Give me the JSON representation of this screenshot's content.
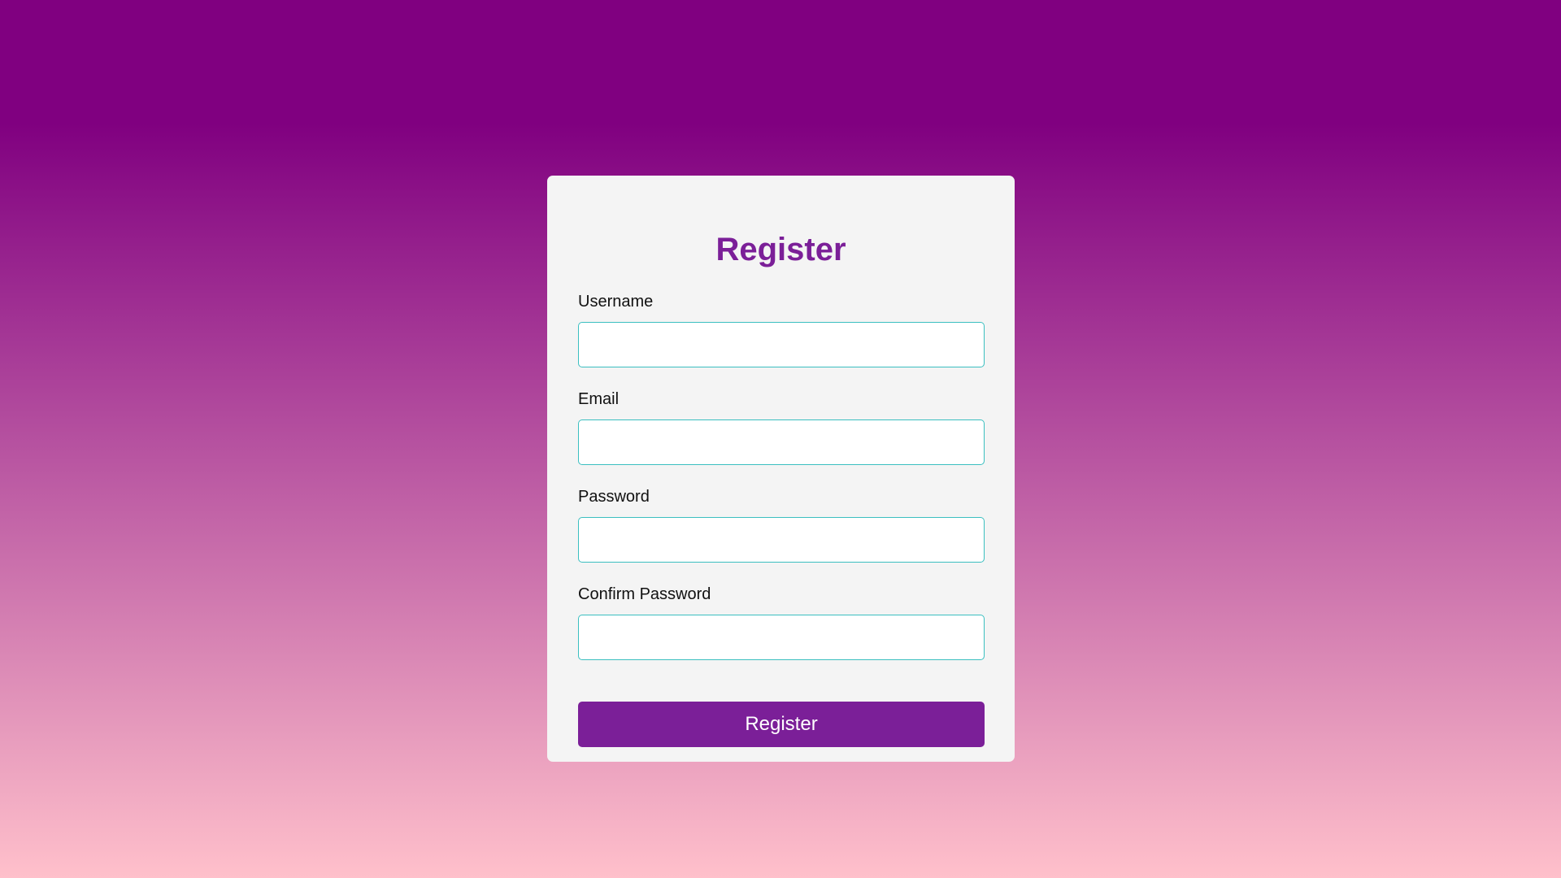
{
  "form": {
    "title": "Register",
    "fields": [
      {
        "label": "Username",
        "value": "",
        "placeholder": ""
      },
      {
        "label": "Email",
        "value": "",
        "placeholder": ""
      },
      {
        "label": "Password",
        "value": "",
        "placeholder": ""
      },
      {
        "label": "Confirm Password",
        "value": "",
        "placeholder": ""
      }
    ],
    "submit_label": "Register"
  },
  "colors": {
    "accent": "#7b1f98",
    "input_border": "#3bbfc0",
    "card_background": "#f4f4f4",
    "gradient_top": "#800080",
    "gradient_bottom": "#ffc0cb"
  }
}
